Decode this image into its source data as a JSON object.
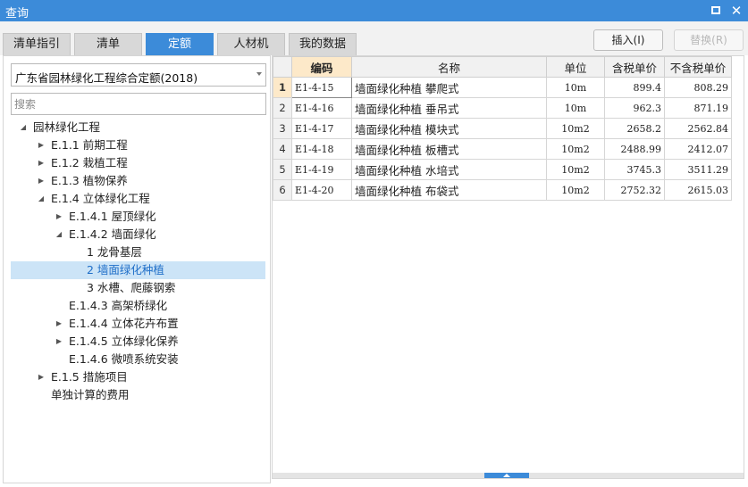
{
  "window": {
    "title": "查询"
  },
  "tabs": [
    {
      "label": "清单指引",
      "active": false
    },
    {
      "label": "清单",
      "active": false
    },
    {
      "label": "定额",
      "active": true
    },
    {
      "label": "人材机",
      "active": false
    },
    {
      "label": "我的数据",
      "active": false
    }
  ],
  "actions": {
    "insert_label": "插入(I)",
    "replace_label": "替换(R)"
  },
  "left_panel": {
    "quota_library": "广东省园林绿化工程综合定额(2018)",
    "search_placeholder": "搜索",
    "tree": [
      {
        "label": "园林绿化工程",
        "level": 0,
        "toggle": "expanded"
      },
      {
        "label": "E.1.1 前期工程",
        "level": 1,
        "toggle": "collapsed"
      },
      {
        "label": "E.1.2 栽植工程",
        "level": 1,
        "toggle": "collapsed"
      },
      {
        "label": "E.1.3 植物保养",
        "level": 1,
        "toggle": "collapsed"
      },
      {
        "label": "E.1.4 立体绿化工程",
        "level": 1,
        "toggle": "expanded"
      },
      {
        "label": "E.1.4.1 屋顶绿化",
        "level": 2,
        "toggle": "collapsed"
      },
      {
        "label": "E.1.4.2 墙面绿化",
        "level": 2,
        "toggle": "expanded"
      },
      {
        "label": "1 龙骨基层",
        "level": 3,
        "toggle": "none"
      },
      {
        "label": "2 墙面绿化种植",
        "level": 3,
        "toggle": "none",
        "selected": true
      },
      {
        "label": "3 水槽、爬藤钢索",
        "level": 3,
        "toggle": "none"
      },
      {
        "label": "E.1.4.3 高架桥绿化",
        "level": 2,
        "toggle": "none"
      },
      {
        "label": "E.1.4.4 立体花卉布置",
        "level": 2,
        "toggle": "collapsed"
      },
      {
        "label": "E.1.4.5 立体绿化保养",
        "level": 2,
        "toggle": "collapsed"
      },
      {
        "label": "E.1.4.6 微喷系统安装",
        "level": 2,
        "toggle": "none"
      },
      {
        "label": "E.1.5 措施项目",
        "level": 1,
        "toggle": "collapsed"
      },
      {
        "label": "单独计算的费用",
        "level": 1,
        "toggle": "none"
      }
    ]
  },
  "table": {
    "columns": [
      "编码",
      "名称",
      "单位",
      "含税单价",
      "不含税单价"
    ],
    "rows": [
      {
        "idx": "1",
        "code": "E1-4-15",
        "name": "墙面绿化种植 攀爬式",
        "unit": "10m",
        "price_tax": "899.4",
        "price_notax": "808.29"
      },
      {
        "idx": "2",
        "code": "E1-4-16",
        "name": "墙面绿化种植 垂吊式",
        "unit": "10m",
        "price_tax": "962.3",
        "price_notax": "871.19"
      },
      {
        "idx": "3",
        "code": "E1-4-17",
        "name": "墙面绿化种植 模块式",
        "unit": "10m2",
        "price_tax": "2658.2",
        "price_notax": "2562.84"
      },
      {
        "idx": "4",
        "code": "E1-4-18",
        "name": "墙面绿化种植 板槽式",
        "unit": "10m2",
        "price_tax": "2488.99",
        "price_notax": "2412.07"
      },
      {
        "idx": "5",
        "code": "E1-4-19",
        "name": "墙面绿化种植 水培式",
        "unit": "10m2",
        "price_tax": "3745.3",
        "price_notax": "3511.29"
      },
      {
        "idx": "6",
        "code": "E1-4-20",
        "name": "墙面绿化种植 布袋式",
        "unit": "10m2",
        "price_tax": "2752.32",
        "price_notax": "2615.03"
      }
    ]
  }
}
